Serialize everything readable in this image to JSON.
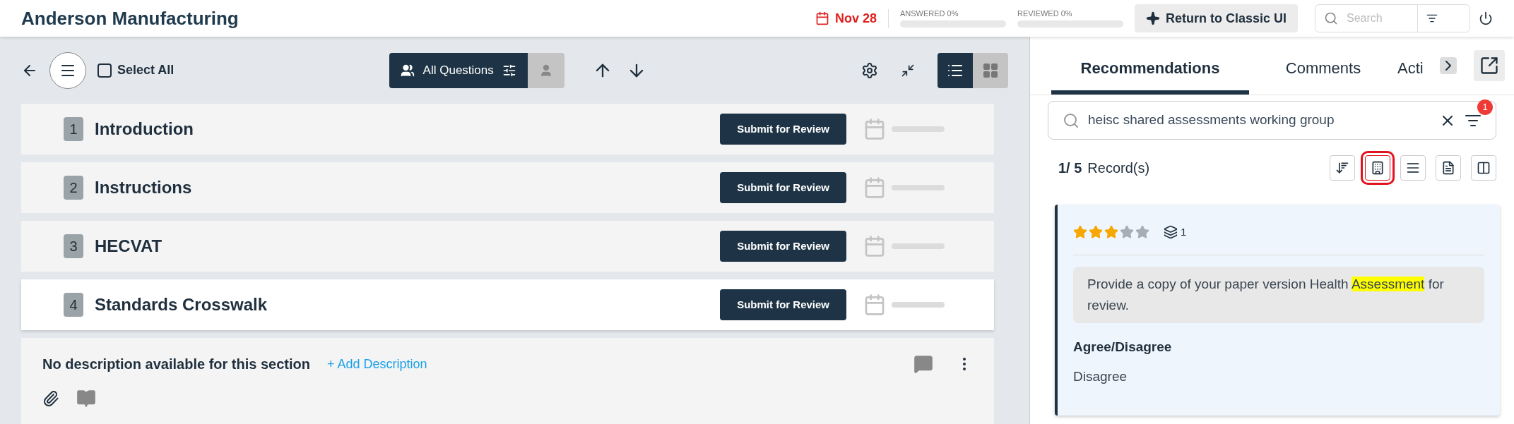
{
  "header": {
    "title": "Anderson Manufacturing",
    "due_date": "Nov 28",
    "progress": [
      {
        "label": "ANSWERED 0%",
        "level": 0
      },
      {
        "label": "REVIEWED 0%",
        "level": 0
      }
    ],
    "classic_button": "Return to Classic UI",
    "search": {
      "placeholder": "Search"
    }
  },
  "toolbar": {
    "select_all": {
      "label": "Select All",
      "checked": false
    },
    "filter_tabs": [
      {
        "label": "All Questions",
        "selected": true
      },
      {
        "selected": false
      }
    ],
    "view_modes": [
      {
        "kind": "list",
        "selected": true
      },
      {
        "kind": "grid",
        "selected": false
      }
    ]
  },
  "sections": [
    {
      "number": "1",
      "title": "Introduction",
      "button": "Submit for Review",
      "expanded": false
    },
    {
      "number": "2",
      "title": "Instructions",
      "button": "Submit for Review",
      "expanded": false
    },
    {
      "number": "3",
      "title": "HECVAT",
      "button": "Submit for Review",
      "expanded": false
    },
    {
      "number": "4",
      "title": "Standards Crosswalk",
      "button": "Submit for Review",
      "expanded": true
    }
  ],
  "section_detail": {
    "description": "No description available for this section",
    "add_link": "+ Add Description"
  },
  "panel": {
    "tabs": [
      {
        "label": "Recommendations",
        "selected": true
      },
      {
        "label": "Comments",
        "selected": false
      },
      {
        "label": "Acti",
        "selected": false
      }
    ],
    "search": {
      "value": "heisc shared assessments working group",
      "filter_count": "1"
    },
    "records": {
      "position": "1/ 5",
      "label": "Record(s)"
    },
    "tools": [
      {
        "kind": "sort",
        "selected": false
      },
      {
        "kind": "building",
        "selected": true
      },
      {
        "kind": "lines",
        "selected": false
      },
      {
        "kind": "document",
        "selected": false
      },
      {
        "kind": "columns",
        "selected": false
      }
    ],
    "card": {
      "stars": 3,
      "layers": "1",
      "text_parts": [
        {
          "text": "Provide a copy of your paper version Health ",
          "highlighted": false
        },
        {
          "text": "Assessment",
          "highlighted": true
        },
        {
          "text": " for review.",
          "highlighted": false
        }
      ],
      "field_label": "Agree/Disagree",
      "field_value": "Disagree"
    }
  }
}
